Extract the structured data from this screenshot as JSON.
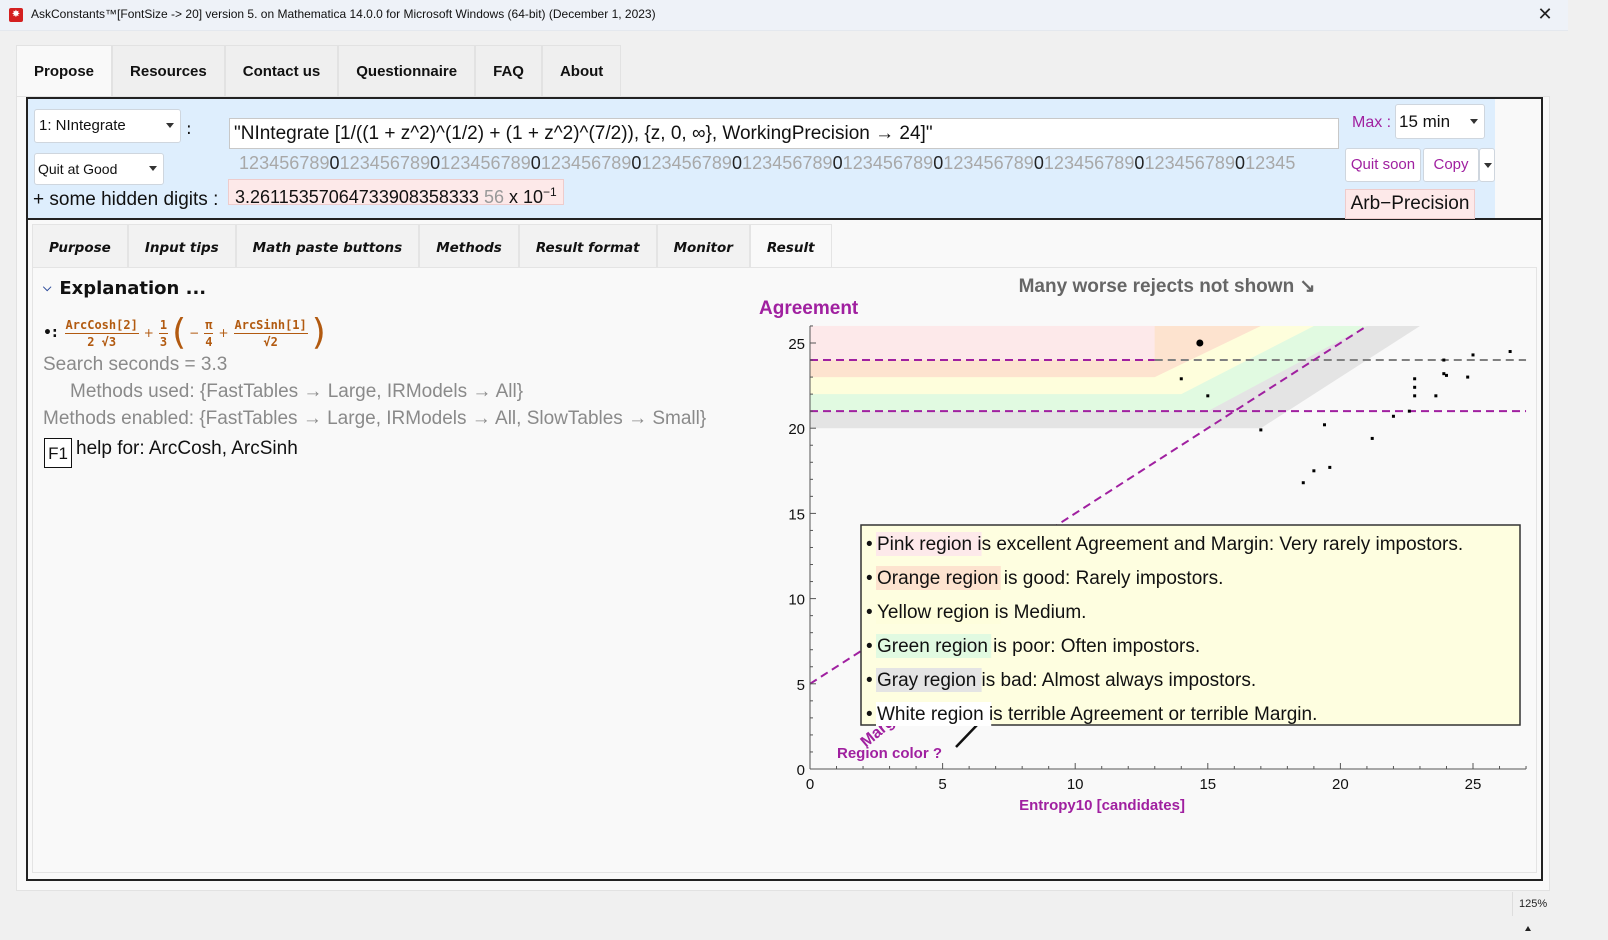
{
  "window": {
    "title": "AskConstants™[FontSize -> 20] version 5. on  Mathematica  14.0.0 for Microsoft Windows (64-bit) (December 1, 2023)",
    "close_label": "✕",
    "zoom_level": "125%"
  },
  "main_tabs": [
    {
      "label": "Propose",
      "active": true
    },
    {
      "label": "Resources",
      "active": false
    },
    {
      "label": "Contact us",
      "active": false
    },
    {
      "label": "Questionnaire",
      "active": false
    },
    {
      "label": "FAQ",
      "active": false
    },
    {
      "label": "About",
      "active": false
    }
  ],
  "input": {
    "method_select": "1: NIntegrate",
    "colon": ":",
    "quit_select": "Quit at Good",
    "expression": "\"NIntegrate [1/((1 + z^2)^(1/2) + (1 + z^2)^(7/2)),  {z, 0, ∞},  WorkingPrecision → 24]\"",
    "ruler_groups": [
      "123456789",
      "0",
      "123456789",
      "0",
      "123456789",
      "0",
      "123456789",
      "0",
      "123456789",
      "0",
      "123456789",
      "0",
      "123456789",
      "0",
      "123456789",
      "0",
      "123456789",
      "0",
      "123456789",
      "0",
      "12345"
    ],
    "hidden_digits_label": "+ some hidden digits :",
    "result_value": "3.26115357064733908358333",
    "result_extra_digits": "56",
    "result_times": "x",
    "result_base": "10",
    "result_exponent": "−1",
    "max_label": "Max :",
    "max_select": "15 min",
    "quit_soon_label": "Quit soon",
    "copy_label": "Copy",
    "precision_badge": "Arb−Precision"
  },
  "sub_tabs": [
    {
      "label": "Purpose",
      "active": false
    },
    {
      "label": "Input tips",
      "active": false
    },
    {
      "label": "Math paste buttons",
      "active": false
    },
    {
      "label": "Methods",
      "active": false
    },
    {
      "label": "Result format",
      "active": false
    },
    {
      "label": "Monitor",
      "active": false
    },
    {
      "label": "Result",
      "active": true
    }
  ],
  "result": {
    "explanation_heading": "Explanation ...",
    "formula": {
      "bullet": "•:",
      "term1_num": "ArcCosh[2]",
      "term1_den": "2 √3",
      "plus": "+",
      "term2_num": "1",
      "term2_den": "3",
      "open_paren": "(",
      "minus": "−",
      "pi_num": "π",
      "pi_den": "4",
      "term3_num": "ArcSinh[1]",
      "term3_den": "√2",
      "close_paren": ")"
    },
    "search_seconds": "Search seconds = 3.3",
    "methods_used": "Methods used: {FastTables → Large, IRModels → All}",
    "methods_enabled": "Methods enabled: {FastTables → Large, IRModels → All, SlowTables → Small}",
    "f1_key": "F1",
    "help_text": "help for:  ArcCosh,  ArcSinh"
  },
  "colors": {
    "accent_purple": "#a020a0",
    "pink_region": "#fde9ea",
    "orange_region": "#fde3cf",
    "yellow_region": "#fefedc",
    "green_region": "#e1fae1",
    "gray_region": "#e4e4e4",
    "result_bg": "#fde9e9",
    "input_bar_bg": "#deeefd",
    "formula_color": "#b25a10"
  },
  "chart_data": {
    "type": "scatter",
    "title": "Many worse rejects not shown ↘",
    "xlabel": "Entropy10 [candidates]",
    "ylabel": "Agreement",
    "xlim": [
      0,
      27
    ],
    "ylim": [
      0,
      26
    ],
    "xticks": [
      0,
      5,
      10,
      15,
      20,
      25
    ],
    "yticks": [
      0,
      5,
      10,
      15,
      20,
      25
    ],
    "grid": false,
    "highlighted_point": {
      "x": 14.7,
      "y": 25.0
    },
    "points": [
      {
        "x": 14.0,
        "y": 22.9
      },
      {
        "x": 15.0,
        "y": 21.9
      },
      {
        "x": 17.0,
        "y": 19.9
      },
      {
        "x": 18.6,
        "y": 16.8
      },
      {
        "x": 19.0,
        "y": 17.5
      },
      {
        "x": 19.6,
        "y": 17.7
      },
      {
        "x": 19.4,
        "y": 20.2
      },
      {
        "x": 21.2,
        "y": 19.4
      },
      {
        "x": 22.0,
        "y": 20.7
      },
      {
        "x": 22.6,
        "y": 21.0
      },
      {
        "x": 22.8,
        "y": 22.9
      },
      {
        "x": 22.8,
        "y": 22.4
      },
      {
        "x": 22.8,
        "y": 21.9
      },
      {
        "x": 23.6,
        "y": 21.9
      },
      {
        "x": 23.9,
        "y": 24.0
      },
      {
        "x": 23.9,
        "y": 23.2
      },
      {
        "x": 24.0,
        "y": 23.1
      },
      {
        "x": 24.8,
        "y": 23.0
      },
      {
        "x": 25.0,
        "y": 24.3
      },
      {
        "x": 26.4,
        "y": 24.5
      }
    ],
    "reference_lines": [
      {
        "name": "agreement-threshold-high",
        "y": 24,
        "style": "dashed",
        "color": "#a020a0",
        "x_range": [
          0,
          13
        ],
        "then_color": "#808080"
      },
      {
        "name": "agreement-threshold-low",
        "y": 21,
        "style": "dashed",
        "color": "#a020a0"
      },
      {
        "name": "margin-line",
        "from": [
          0,
          5
        ],
        "to": [
          21,
          26
        ],
        "style": "dashed",
        "color": "#a020a0"
      }
    ],
    "regions": [
      {
        "name": "pink",
        "y_range": [
          24,
          26
        ],
        "x_end_at_top": 13.0
      },
      {
        "name": "orange",
        "y_range": [
          23,
          26
        ],
        "x_end": 13.0,
        "slant_end_x_at_top": 17.0
      },
      {
        "name": "yellow",
        "y_range": [
          22,
          26
        ],
        "x_end": 14.0,
        "slant_end_x_at_top": 19.0
      },
      {
        "name": "green",
        "y_range": [
          21,
          26
        ],
        "x_end": 15.0,
        "slant_end_x_at_top": 21.0
      },
      {
        "name": "gray",
        "y_range": [
          20,
          26
        ],
        "x_end": 17.0,
        "slant_end_x_at_top": 23.0
      }
    ],
    "annotations": {
      "margin_label": "Margin",
      "region_color_label": "Region color ?"
    },
    "legend": {
      "placement": "center-right",
      "items": [
        {
          "swatch": "Pink region",
          "text": " is excellent Agreement and Margin:  Very rarely impostors.",
          "color": "#fde9ea"
        },
        {
          "swatch": "Orange region",
          "text": " is good:  Rarely impostors.",
          "color": "#fde3cf"
        },
        {
          "swatch": "Yellow region",
          "text": " is Medium.",
          "color": "#fefedc"
        },
        {
          "swatch": "Green region",
          "text": " is poor:  Often impostors.",
          "color": "#e1fae1"
        },
        {
          "swatch": "Gray region",
          "text": " is bad:  Almost always impostors.",
          "color": "#e4e4e4"
        },
        {
          "swatch": "White region",
          "text": " is terrible Agreement or terrible Margin.",
          "color": "#ffffff"
        }
      ]
    }
  }
}
